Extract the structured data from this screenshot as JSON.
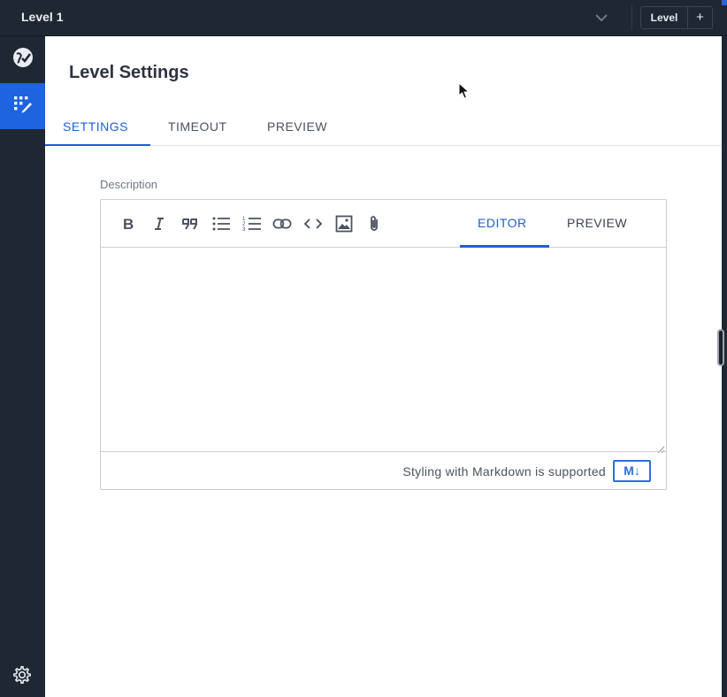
{
  "topbar": {
    "title": "Level 1",
    "level_button_label": "Level",
    "add_button_label": "+"
  },
  "rail": {
    "items": [
      "globe-check-icon",
      "grid-edit-icon"
    ],
    "settings_icon": "gear-icon"
  },
  "page": {
    "title": "Level Settings",
    "tabs": [
      {
        "label": "SETTINGS",
        "active": true
      },
      {
        "label": "TIMEOUT",
        "active": false
      },
      {
        "label": "PREVIEW",
        "active": false
      }
    ]
  },
  "description": {
    "label": "Description",
    "value": "",
    "toolbar": [
      "bold-icon",
      "italic-icon",
      "quote-icon",
      "bullet-list-icon",
      "numbered-list-icon",
      "link-icon",
      "code-icon",
      "image-icon",
      "attachment-icon"
    ],
    "mode_tabs": [
      {
        "label": "EDITOR",
        "active": true
      },
      {
        "label": "PREVIEW",
        "active": false
      }
    ],
    "footer_text": "Styling with Markdown is supported",
    "markdown_badge": "M↓"
  },
  "colors": {
    "accent": "#1f5fd1",
    "rail_bg": "#1f2733",
    "active_rail": "#1e63e0"
  }
}
